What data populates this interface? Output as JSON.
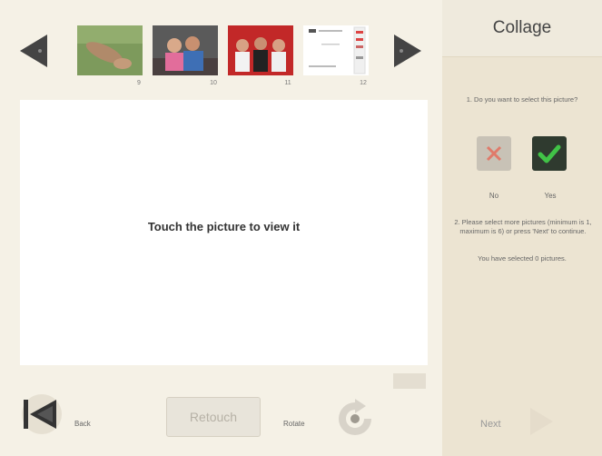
{
  "thumbnails": [
    {
      "number": "9"
    },
    {
      "number": "10"
    },
    {
      "number": "11"
    },
    {
      "number": "12"
    }
  ],
  "viewer": {
    "message": "Touch the picture to view it"
  },
  "toolbar": {
    "back_label": "Back",
    "retouch_label": "Retouch",
    "rotate_label": "Rotate",
    "next_label": "Next"
  },
  "sidebar": {
    "title": "Collage",
    "question1": "1. Do you want to select this picture?",
    "no_label": "No",
    "yes_label": "Yes",
    "instruction": "2. Please select more pictures (minimum is 1, maximum is 6) or press 'Next' to continue.",
    "status": "You have selected 0 pictures."
  },
  "colors": {
    "arrow": "#444444",
    "yes_button": "#2f3a2f",
    "yes_check": "#41c247",
    "no_button": "#c8c2b6",
    "no_x": "#e07a6a"
  }
}
